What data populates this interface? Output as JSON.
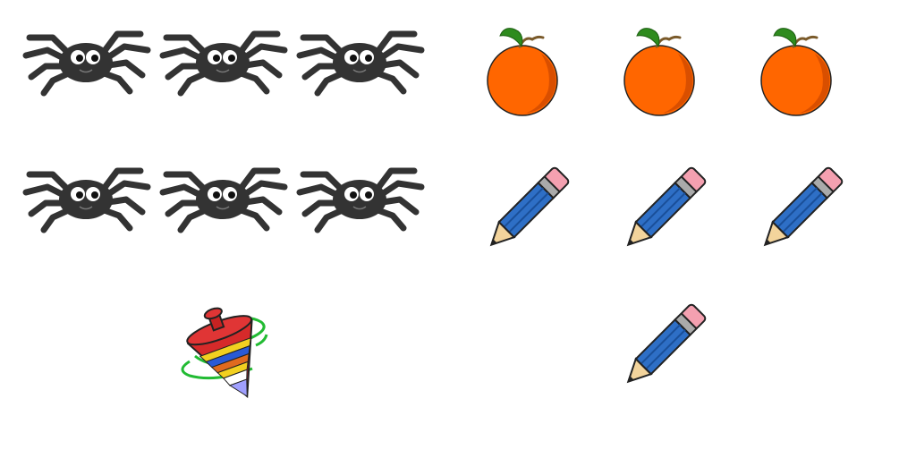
{
  "items": [
    {
      "icon": "spider-icon"
    },
    {
      "icon": "spider-icon"
    },
    {
      "icon": "spider-icon"
    },
    {
      "icon": "spider-icon"
    },
    {
      "icon": "spider-icon"
    },
    {
      "icon": "spider-icon"
    },
    {
      "icon": "spinning-top-icon"
    },
    {
      "icon": "orange-icon"
    },
    {
      "icon": "orange-icon"
    },
    {
      "icon": "orange-icon"
    },
    {
      "icon": "pencil-icon"
    },
    {
      "icon": "pencil-icon"
    },
    {
      "icon": "pencil-icon"
    },
    {
      "icon": "pencil-icon"
    }
  ],
  "colors": {
    "spider": "#333333",
    "orange": "#ff6600",
    "orange_shade": "#d94f00",
    "leaf": "#2e8b1e",
    "pencil_body": "#2e6fc6",
    "pencil_eraser": "#f4a0b0",
    "pencil_wood": "#f3d49c",
    "top_red": "#d62a2a",
    "top_swirl": "#22bb33"
  }
}
